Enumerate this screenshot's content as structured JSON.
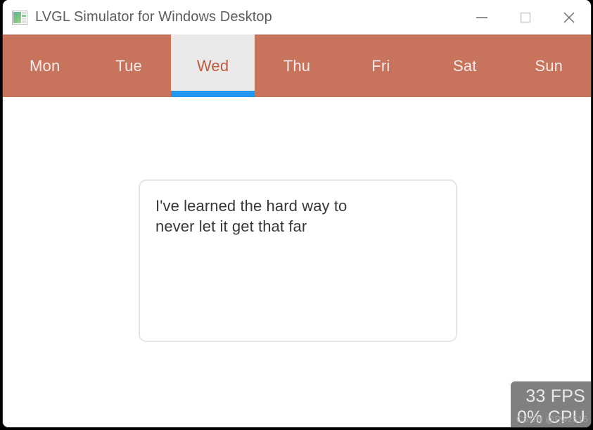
{
  "window": {
    "title": "LVGL Simulator for Windows Desktop",
    "icon": "app-window-icon",
    "controls": {
      "minimize": "minimize-icon",
      "maximize": "maximize-icon",
      "close": "close-icon"
    }
  },
  "tabs": {
    "active_index": 2,
    "items": [
      {
        "label": "Mon"
      },
      {
        "label": "Tue"
      },
      {
        "label": "Wed"
      },
      {
        "label": "Thu"
      },
      {
        "label": "Fri"
      },
      {
        "label": "Sat"
      },
      {
        "label": "Sun"
      }
    ]
  },
  "content": {
    "textarea": {
      "value": "I've learned the hard way to\nnever let it get that far",
      "placeholder": ""
    }
  },
  "overlay": {
    "fps": "33 FPS",
    "cpu": "0% CPU",
    "watermark": "CSDN @Pwz515"
  },
  "colors": {
    "tabbar_bg": "#c8735c",
    "tab_active_bg": "#e9e9e9",
    "tab_active_text": "#bf5a3f",
    "tab_indicator": "#2196f3",
    "title_text": "#5d5d5d",
    "card_border": "#e6e6e6",
    "overlay_bg": "#808080"
  }
}
